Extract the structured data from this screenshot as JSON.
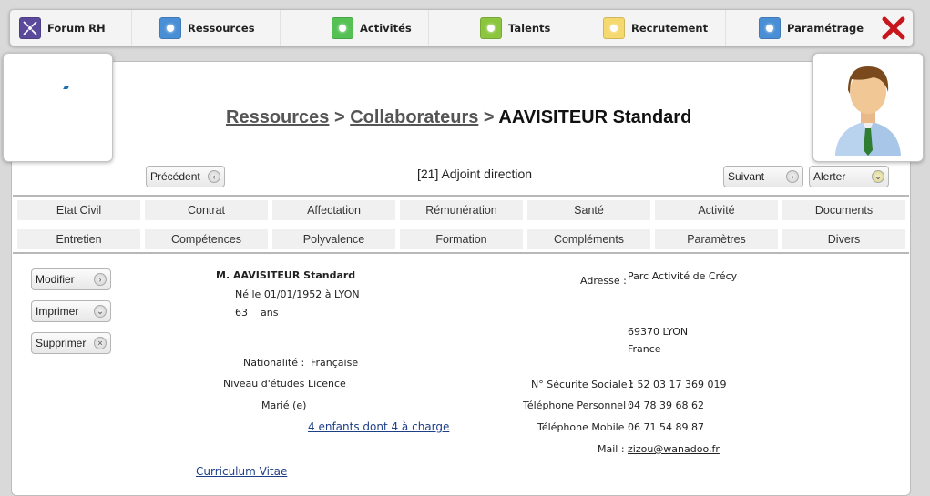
{
  "nav": {
    "items": [
      {
        "label": "Forum RH",
        "icon": "forum-rh-icon",
        "color": "#5b4a9b"
      },
      {
        "label": "Ressources",
        "icon": "ressources-icon",
        "color": "#4a8fd6"
      },
      {
        "label": "Activités",
        "icon": "activites-icon",
        "color": "#55c155"
      },
      {
        "label": "Talents",
        "icon": "talents-icon",
        "color": "#8cc63f"
      },
      {
        "label": "Recrutement",
        "icon": "recrutement-icon",
        "color": "#f5d86e"
      },
      {
        "label": "Paramétrage",
        "icon": "parametrage-icon",
        "color": "#4a8fd6"
      }
    ],
    "close_icon": "close-icon"
  },
  "breadcrumb": {
    "root": "Ressources",
    "sep1": " > ",
    "section": "Collaborateurs",
    "sep2": " > ",
    "current": "AAVISITEUR Standard"
  },
  "record": {
    "previous_label": "Précédent",
    "next_label": "Suivant",
    "alert_label": "Alerter",
    "subtitle": "[21] Adjoint direction"
  },
  "tabs": {
    "row1": [
      "Etat Civil",
      "Contrat",
      "Affectation",
      "Rémunération",
      "Santé",
      "Activité",
      "Documents"
    ],
    "row2": [
      "Entretien",
      "Compétences",
      "Polyvalence",
      "Formation",
      "Compléments",
      "Paramètres",
      "Divers"
    ]
  },
  "actions": {
    "modify": "Modifier",
    "print": "Imprimer",
    "delete": "Supprimer"
  },
  "person": {
    "civility": "M.",
    "name": "AAVISITEUR Standard",
    "birth": "Né le 01/01/1952 à LYON",
    "age": "63",
    "age_unit": "ans",
    "nationality_label": "Nationalité :",
    "nationality": "Française",
    "education_label": "Niveau d'études :",
    "education": "Licence",
    "marital": "Marié (e)",
    "children_link": "4 enfants dont 4 à charge",
    "cv_link": "Curriculum Vitae"
  },
  "contact": {
    "address_label": "Adresse :",
    "address_line1": "Parc Activité de Crécy",
    "address_city": "69370 LYON",
    "address_country": "France",
    "ssn_label": "N° Sécurite Sociale :",
    "ssn": "1 52 03 17 369 019",
    "phone_label": "Téléphone Personnel :",
    "phone": "04 78 39 68 62",
    "mobile_label": "Téléphone Mobile :",
    "mobile": "06 71 54 89 87",
    "mail_label": "Mail :",
    "mail": "zizou@wanadoo.fr"
  }
}
